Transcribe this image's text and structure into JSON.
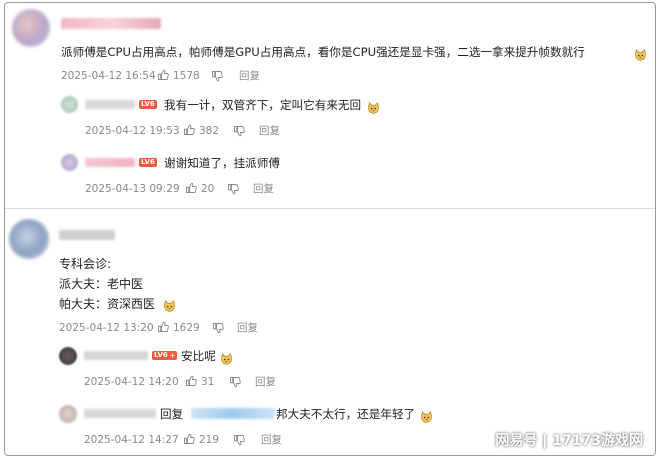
{
  "comments": [
    {
      "text": "派师傅是CPU占用高点，帕师傅是GPU占用高点，看你是CPU强还是显卡强，二选一拿来提升帧数就行",
      "time": "2025-04-12 16:54",
      "likes": "1578",
      "reply": "回复",
      "replies": [
        {
          "text": "我有一计，双管齐下，定叫它有来无回",
          "time": "2025-04-12 19:53",
          "likes": "382",
          "reply": "回复"
        },
        {
          "text": "谢谢知道了，挂派师傅",
          "time": "2025-04-13 09:29",
          "likes": "20",
          "reply": "回复"
        }
      ]
    },
    {
      "lines": [
        "专科会诊:",
        "派大夫：老中医",
        "帕大夫：资深西医"
      ],
      "time": "2025-04-12 13:20",
      "likes": "1629",
      "reply": "回复",
      "replies": [
        {
          "text": "安比呢",
          "time": "2025-04-12 14:20",
          "likes": "31",
          "reply": "回复"
        },
        {
          "prefix": "回复",
          "text": "邦大夫不太行，还是年轻了",
          "time": "2025-04-12 14:27",
          "likes": "219",
          "reply": "回复"
        }
      ]
    }
  ],
  "level_badge": "LV6",
  "watermark": "网易号 | 17173游戏网",
  "icons": [
    "thumbs-up-icon",
    "thumbs-down-icon",
    "cat-emoji-icon"
  ],
  "colors": {
    "badge": "#f05a3c",
    "meta": "#8a8a8a",
    "divider": "#dcdcdc"
  }
}
